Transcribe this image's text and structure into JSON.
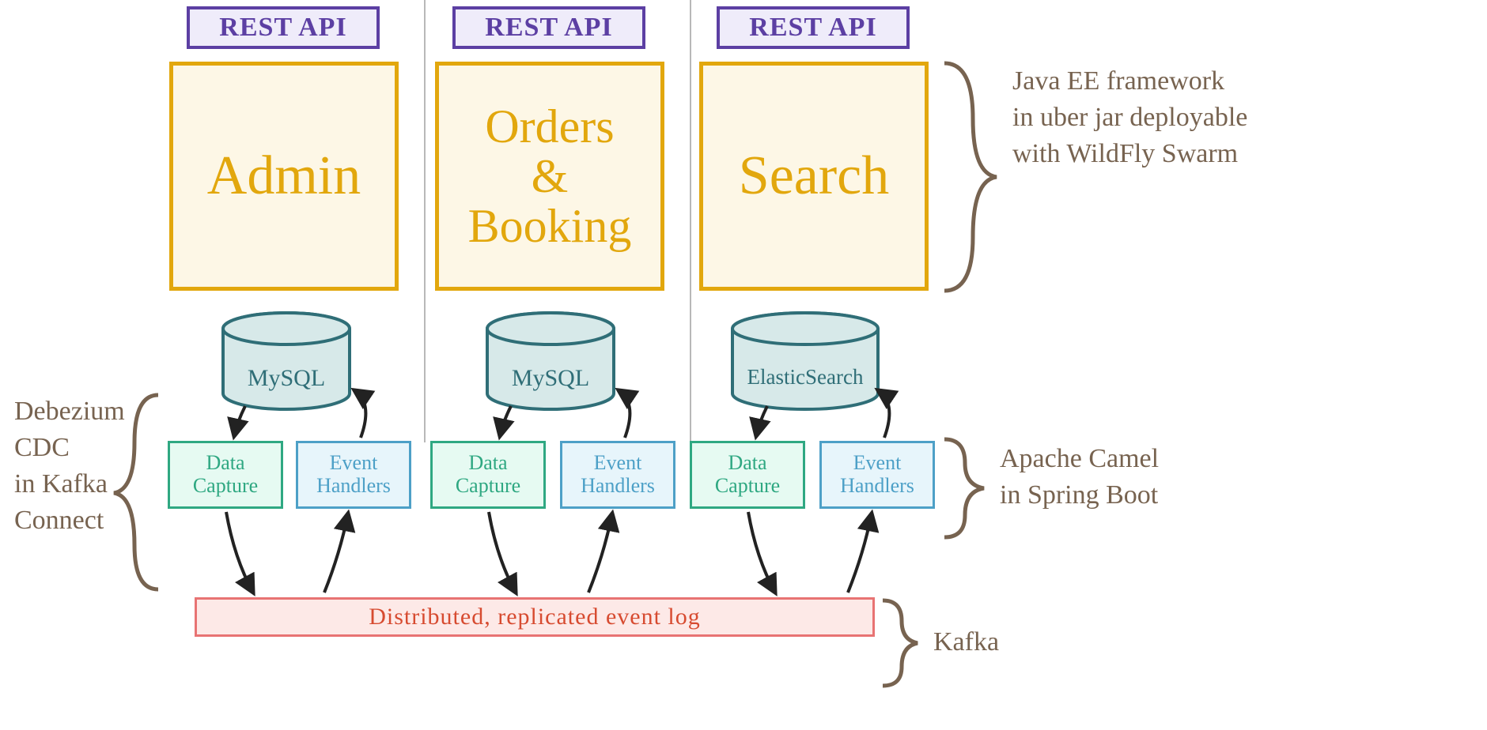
{
  "rest_label": "REST API",
  "services": {
    "admin": "Admin",
    "orders": "Orders\n&\nBooking",
    "search": "Search"
  },
  "db": {
    "admin": "MySQL",
    "orders": "MySQL",
    "search": "ElasticSearch"
  },
  "capture_label": "Data\nCapture",
  "handler_label": "Event\nHandlers",
  "bus_label": "Distributed, replicated event  log",
  "annotations": {
    "javaee": "Java EE framework\nin uber jar deployable\nwith WildFly Swarm",
    "debezium": "Debezium\nCDC\nin Kafka\nConnect",
    "camel": "Apache Camel\nin Spring Boot",
    "kafka": "Kafka"
  },
  "colors": {
    "purple": "#5c3fa3",
    "orange": "#e2a70d",
    "green": "#2fa882",
    "blue": "#4da0c7",
    "red": "#e87373",
    "brown": "#776350",
    "dbstroke": "#2f6e77",
    "dbfill": "#d7e9e9"
  }
}
